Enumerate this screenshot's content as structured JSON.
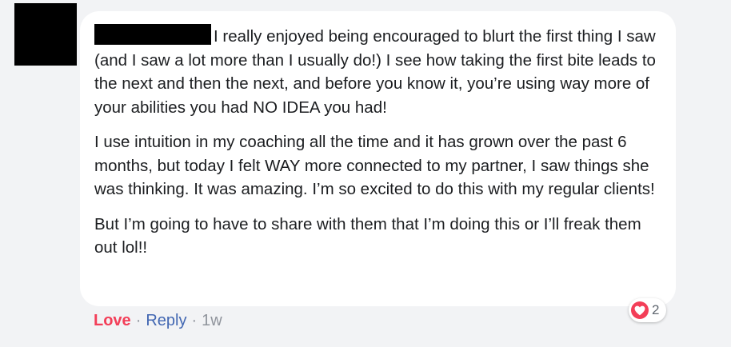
{
  "comment": {
    "paragraphs": [
      "I really enjoyed being encouraged to blurt the first thing I saw (and I saw a lot more than I usually do!) I see how taking the first bite leads to the next and then the next, and before you know it, you’re using way more of your abilities you had NO IDEA you had!",
      "I use intuition in my coaching all the time and it has grown over the past 6 months, but today I felt WAY more connected to my partner, I saw things she was thinking. It was amazing. I’m so excited to do this with my regular clients!",
      "But I’m going to have to share with them that I’m doing this or I’ll freak them out lol!!"
    ]
  },
  "reactions": {
    "icon": "heart-icon",
    "color": "#f33e58",
    "count": "2"
  },
  "actions": {
    "love_label": "Love",
    "separator": "·",
    "reply_label": "Reply",
    "timestamp": "1w"
  },
  "colors": {
    "background": "#f2f3f5",
    "bubble": "#ffffff",
    "love": "#f33e58",
    "link": "#4267b2",
    "meta": "#90949c"
  }
}
